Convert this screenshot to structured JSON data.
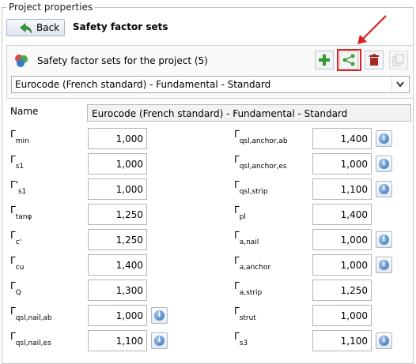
{
  "group_title": "Project properties",
  "toolbar": {
    "back_label": "Back",
    "title": "Safety factor sets"
  },
  "sets_panel": {
    "label": "Safety factor sets for the project (5)",
    "selected": "Eurocode (French standard) - Fundamental - Standard",
    "buttons": [
      "add-icon",
      "share-icon",
      "delete-icon",
      "copy-icon"
    ],
    "highlight_color": "#e02020"
  },
  "name": {
    "label": "Name",
    "value": "Eurocode (French standard) - Fundamental - Standard"
  },
  "left_params": [
    {
      "sym": "Γ",
      "sub": "min",
      "value": "1,000",
      "info": false
    },
    {
      "sym": "Γ",
      "sub": "s1",
      "value": "1,000",
      "info": false
    },
    {
      "sym": "Γ'",
      "sub": "s1",
      "value": "1,000",
      "info": false
    },
    {
      "sym": "Γ",
      "sub": "tanφ",
      "value": "1,250",
      "info": false
    },
    {
      "sym": "Γ",
      "sub": "c'",
      "value": "1,250",
      "info": false
    },
    {
      "sym": "Γ",
      "sub": "cu",
      "value": "1,400",
      "info": false
    },
    {
      "sym": "Γ",
      "sub": "Q",
      "value": "1,300",
      "info": false
    },
    {
      "sym": "Γ",
      "sub": "qsl,nail,ab",
      "value": "1,000",
      "info": true
    },
    {
      "sym": "Γ",
      "sub": "qsl,nail,es",
      "value": "1,100",
      "info": true
    }
  ],
  "right_params": [
    {
      "sym": "Γ",
      "sub": "qsl,anchor,ab",
      "value": "1,400",
      "info": true
    },
    {
      "sym": "Γ",
      "sub": "qsl,anchor,es",
      "value": "1,000",
      "info": true
    },
    {
      "sym": "Γ",
      "sub": "qsl,strip",
      "value": "1,100",
      "info": true
    },
    {
      "sym": "Γ",
      "sub": "pl",
      "value": "1,400",
      "info": false
    },
    {
      "sym": "Γ",
      "sub": "a,nail",
      "value": "1,000",
      "info": true
    },
    {
      "sym": "Γ",
      "sub": "a,anchor",
      "value": "1,000",
      "info": true
    },
    {
      "sym": "Γ",
      "sub": "a,strip",
      "value": "1,250",
      "info": false
    },
    {
      "sym": "Γ",
      "sub": "strut",
      "value": "1,000",
      "info": false
    },
    {
      "sym": "Γ",
      "sub": "s3",
      "value": "1,100",
      "info": true
    }
  ]
}
